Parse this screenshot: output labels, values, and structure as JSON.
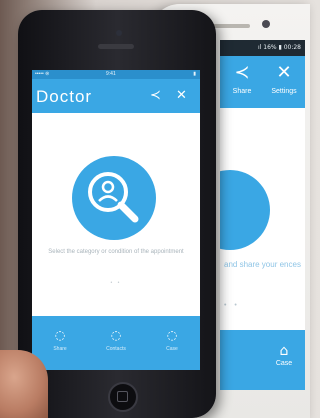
{
  "back_phone": {
    "status_text": "ıl 16% ▮ 00:28",
    "actions": [
      {
        "icon": "share-icon",
        "glyph": "≺",
        "label": "Share"
      },
      {
        "icon": "settings-icon",
        "glyph": "✕",
        "label": "Settings"
      }
    ],
    "body_text": "and share your ences",
    "tab": {
      "icon": "case-icon",
      "glyph": "⌂",
      "label": "Case"
    }
  },
  "front_phone": {
    "status": {
      "left": "••••• ⊜",
      "center": "9:41",
      "right": "▮"
    },
    "app_title": "Doctor",
    "share_glyph": "≺",
    "settings_glyph": "✕",
    "hint_text": "Select the category or condition of the appointment",
    "pager": "• •",
    "tabs": [
      {
        "icon": "chat-icon",
        "glyph": "◌",
        "label": "Share"
      },
      {
        "icon": "person-icon",
        "glyph": "◌",
        "label": "Contacts"
      },
      {
        "icon": "case-icon",
        "glyph": "◌",
        "label": "Case"
      }
    ]
  },
  "colors": {
    "accent": "#3aa7e4",
    "status_dark": "#2b8fcc",
    "front_body": "#141418",
    "back_body": "#f4f3f1"
  }
}
